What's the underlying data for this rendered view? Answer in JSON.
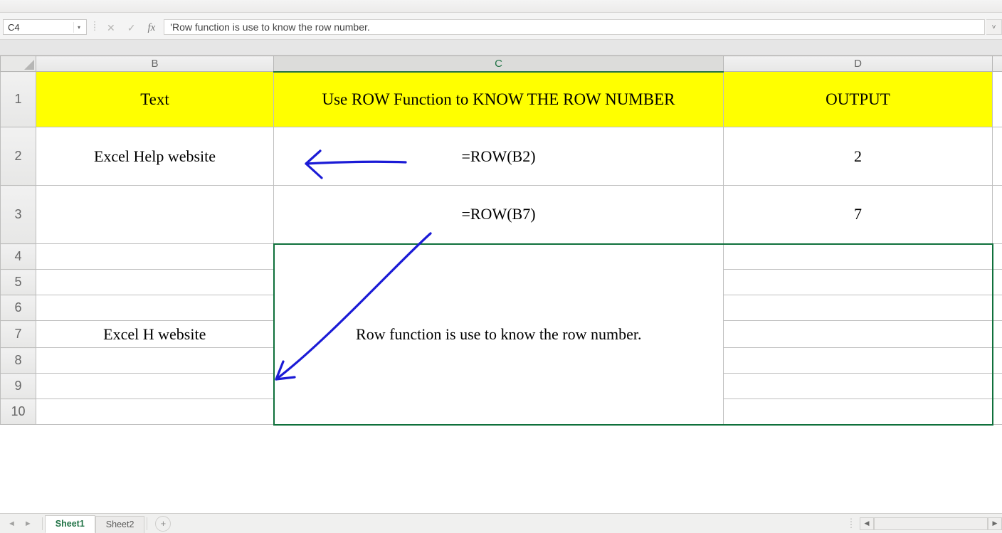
{
  "namebox": {
    "value": "C4"
  },
  "formula_bar": {
    "text": "'Row function is use to know the row number."
  },
  "columns": {
    "corner": "",
    "B": "B",
    "C": "C",
    "D": "D",
    "E": ""
  },
  "rows": [
    "1",
    "2",
    "3",
    "4",
    "5",
    "6",
    "7",
    "8",
    "9",
    "10"
  ],
  "headers": {
    "B": "Text",
    "C": "Use ROW Function to KNOW THE ROW NUMBER",
    "D": "OUTPUT"
  },
  "data": {
    "r2": {
      "B": "Excel Help website",
      "C": "=ROW(B2)",
      "D": "2"
    },
    "r3": {
      "B": "",
      "C": "=ROW(B7)",
      "D": "7"
    },
    "r7": {
      "B": "Excel H website"
    },
    "explanation": "Row function is use to know the row number."
  },
  "tabs": {
    "active": "Sheet1",
    "other": "Sheet2"
  },
  "icons": {
    "dropdown": "▾",
    "cancel": "✕",
    "enter": "✓",
    "fx": "fx",
    "expand": "˅",
    "prev": "◄",
    "next": "►",
    "plus": "+",
    "left": "◀",
    "right": "▶"
  }
}
